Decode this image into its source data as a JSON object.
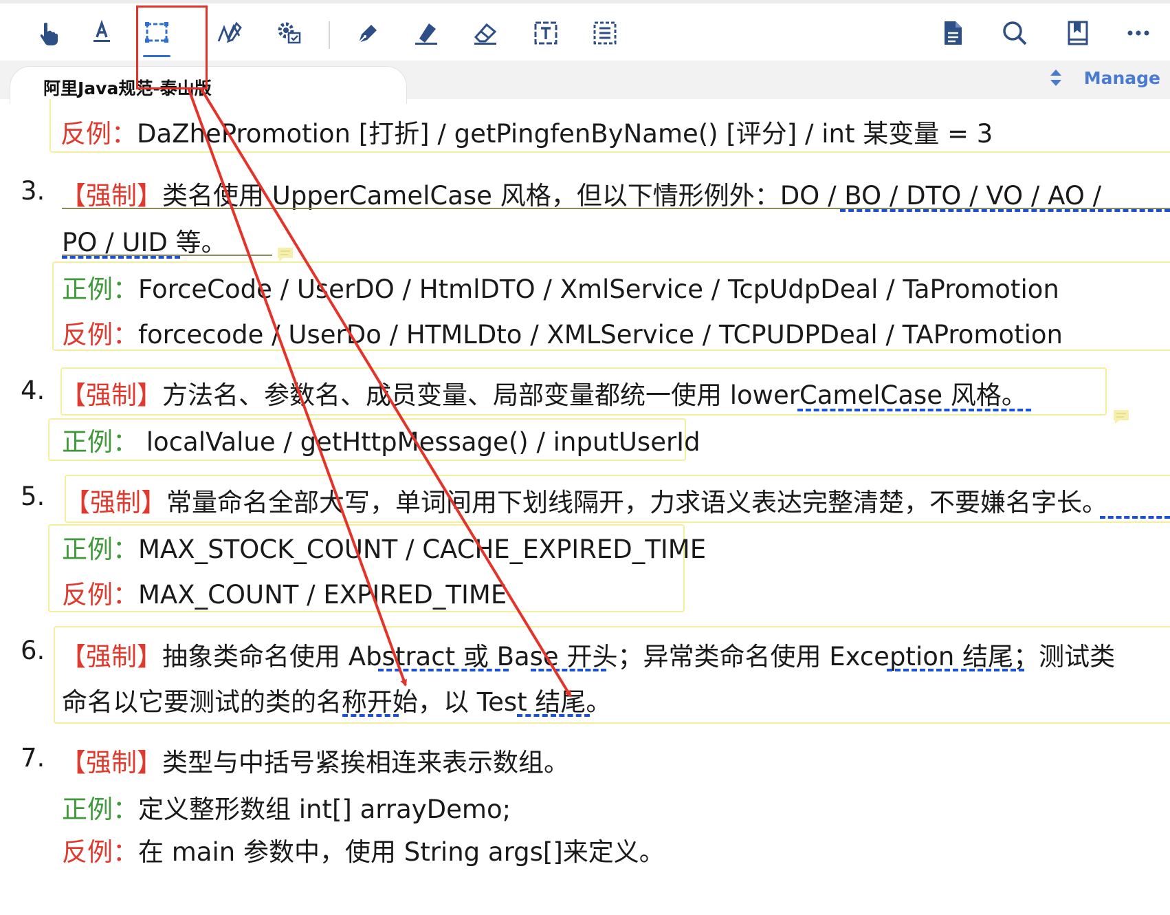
{
  "toolbar": {
    "tools": [
      {
        "name": "pointer-tool",
        "icon": "hand-pointer-icon"
      },
      {
        "name": "text-highlight-tool",
        "icon": "text-underline-icon"
      },
      {
        "name": "rectangle-tool",
        "icon": "dashed-rectangle-icon",
        "active": true
      },
      {
        "name": "signature-tool",
        "icon": "signature-icon"
      },
      {
        "name": "stamp-tool",
        "icon": "gear-stamp-icon"
      },
      {
        "name": "pen-tool",
        "icon": "fountain-pen-icon"
      },
      {
        "name": "highlighter-tool",
        "icon": "highlighter-icon"
      },
      {
        "name": "eraser-tool",
        "icon": "eraser-icon"
      },
      {
        "name": "text-box-tool",
        "icon": "text-box-icon"
      },
      {
        "name": "area-select-tool",
        "icon": "dashed-list-icon"
      }
    ],
    "right_tools": [
      {
        "name": "document-tool",
        "icon": "document-icon"
      },
      {
        "name": "search-tool",
        "icon": "search-icon"
      },
      {
        "name": "bookmark-tool",
        "icon": "bookmark-icon"
      },
      {
        "name": "more-tool",
        "icon": "more-icon"
      }
    ]
  },
  "tab": {
    "title": "阿里Java规范-泰山版",
    "manage_label": "Manage"
  },
  "doc": {
    "counter_example_top": "DaZhePromotion [打折] / getPingfenByName() [评分] / int 某变量 = 3",
    "items": [
      {
        "num": "3.",
        "tag": "【强制】",
        "text_line1": "类名使用 UpperCamelCase 风格，但以下情形例外：DO / BO / DTO / VO / AO /",
        "text_line2": "PO / UID 等。",
        "positive": "ForceCode / UserDO / HtmlDTO / XmlService / TcpUdpDeal / TaPromotion",
        "negative": "forcecode / UserDo / HTMLDto / XMLService / TCPUDPDeal / TAPromotion"
      },
      {
        "num": "4.",
        "tag": "【强制】",
        "text_line1": "方法名、参数名、成员变量、局部变量都统一使用 lowerCamelCase 风格。",
        "positive": " localValue / getHttpMessage() / inputUserId"
      },
      {
        "num": "5.",
        "tag": "【强制】",
        "text_line1": "常量命名全部大写，单词间用下划线隔开，力求语义表达完整清楚，不要嫌名字长。",
        "positive": "MAX_STOCK_COUNT / CACHE_EXPIRED_TIME",
        "negative": "MAX_COUNT / EXPIRED_TIME"
      },
      {
        "num": "6.",
        "tag": "【强制】",
        "text_line1": "抽象类命名使用 Abstract 或 Base 开头；异常类命名使用 Exception 结尾；测试类",
        "text_line2": "命名以它要测试的类的名称开始，以 Test 结尾。"
      },
      {
        "num": "7.",
        "tag": "【强制】",
        "text_line1": "类型与中括号紧挨相连来表示数组。",
        "positive": "定义整形数组 int[] arrayDemo;",
        "negative": "在 main 参数中，使用 String args[]来定义。"
      }
    ],
    "positive_label": "正例：",
    "negative_label": "反例："
  },
  "colors": {
    "tag_red": "#e03a2e",
    "positive_green": "#3f9a3a",
    "annotation_red": "#e4342a",
    "spell_underline_blue": "#1a4fd8",
    "highlight_box_yellow": "#f3ef9a",
    "manage_blue": "#4a7bd0"
  }
}
